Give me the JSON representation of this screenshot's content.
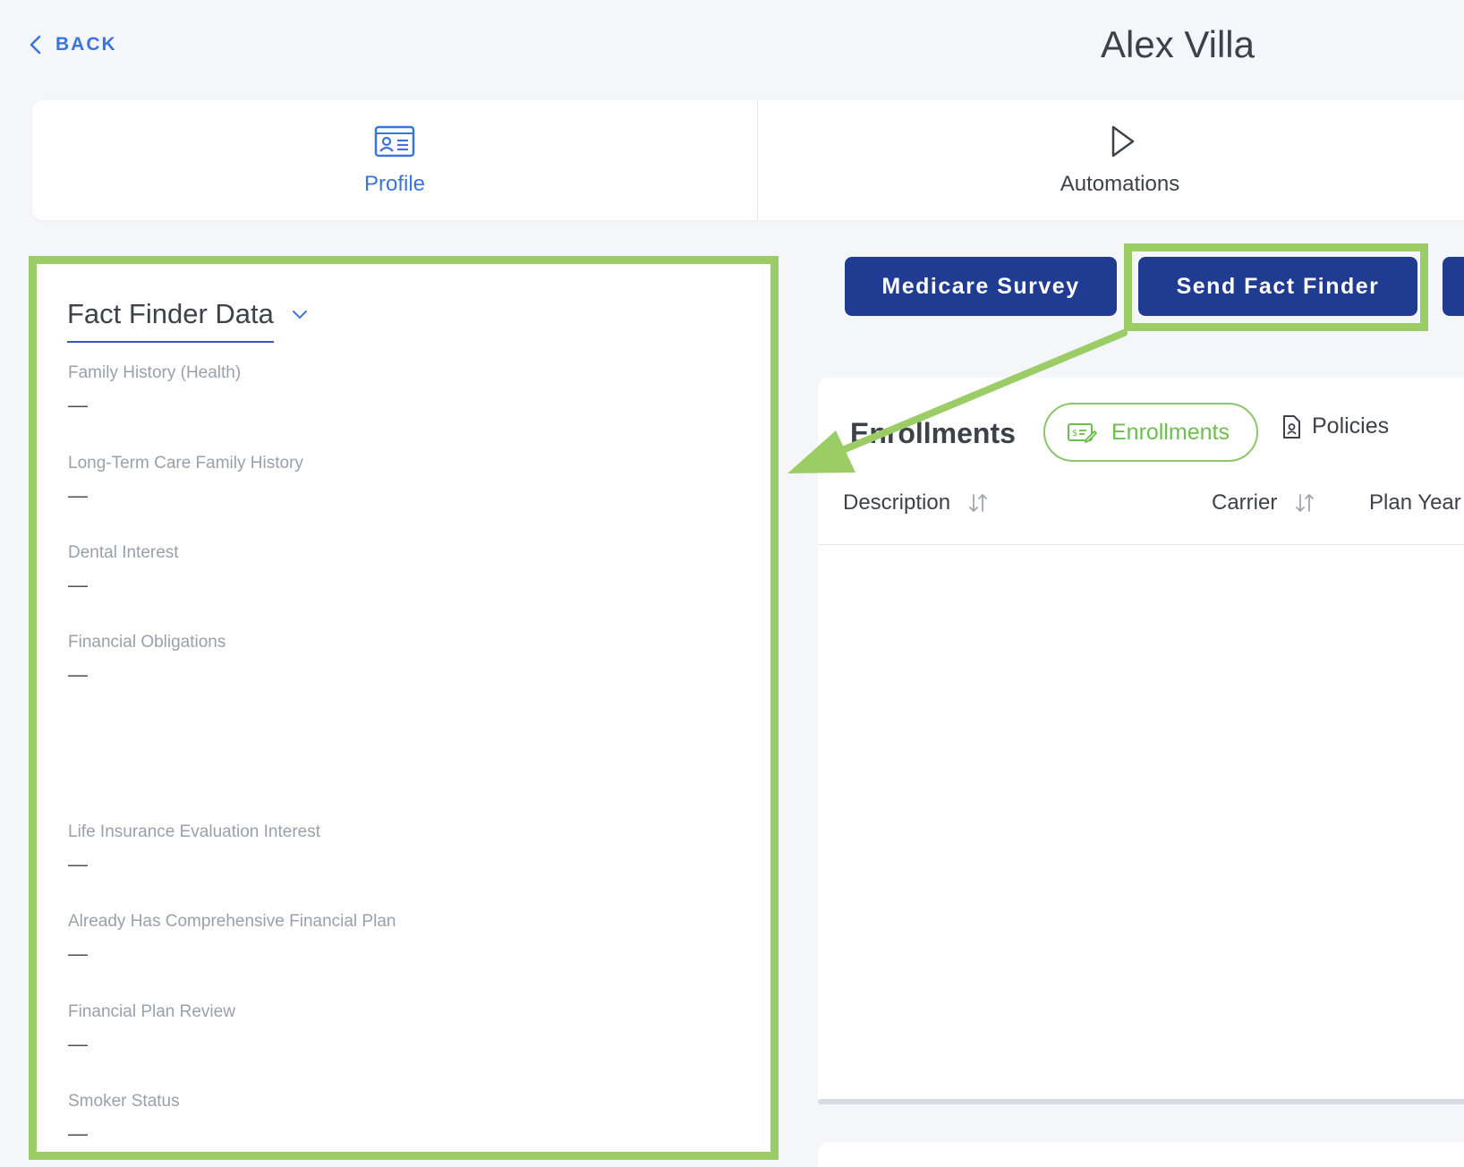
{
  "header": {
    "back_label": "BACK",
    "contact_name": "Alex Villa"
  },
  "tabs": [
    {
      "label": "Profile",
      "icon": "id-card-icon",
      "active": true
    },
    {
      "label": "Automations",
      "icon": "play-icon",
      "active": false
    }
  ],
  "fact_finder": {
    "title": "Fact Finder Data",
    "fields": [
      {
        "label": "Family History (Health)",
        "value": "—"
      },
      {
        "label": "Long-Term Care Family History",
        "value": "—"
      },
      {
        "label": "Dental Interest",
        "value": "—"
      },
      {
        "label": "Financial Obligations",
        "value": "—"
      },
      {
        "label": "Life Insurance Evaluation Interest",
        "value": "—"
      },
      {
        "label": "Already Has Comprehensive Financial Plan",
        "value": "—"
      },
      {
        "label": "Financial Plan Review",
        "value": "—"
      },
      {
        "label": "Smoker Status",
        "value": "—"
      }
    ]
  },
  "actions": {
    "medicare_survey": "Medicare Survey",
    "send_fact_finder": "Send Fact Finder"
  },
  "enrollments": {
    "title": "Enrollments",
    "tab_enrollments": "Enrollments",
    "tab_policies": "Policies",
    "columns": [
      "Description",
      "Carrier",
      "Plan Year"
    ]
  },
  "colors": {
    "accent_blue": "#3a74e0",
    "button_navy": "#1f3b92",
    "highlight_green": "#9ccc65",
    "pill_green": "#6cbf4c"
  }
}
